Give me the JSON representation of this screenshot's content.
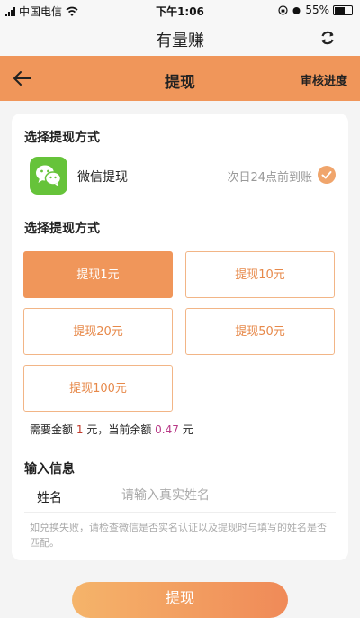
{
  "status_bar": {
    "carrier": "中国电信",
    "time": "下午1:06",
    "battery": "55%"
  },
  "app": {
    "title": "有量赚"
  },
  "nav": {
    "title": "提现",
    "action": "审核进度"
  },
  "method_section": {
    "title": "选择提现方式",
    "option_label": "微信提现",
    "option_note": "次日24点前到账"
  },
  "amount_section": {
    "title": "选择提现方式",
    "options": [
      {
        "label": "提现1元",
        "selected": true
      },
      {
        "label": "提现10元",
        "selected": false
      },
      {
        "label": "提现20元",
        "selected": false
      },
      {
        "label": "提现50元",
        "selected": false
      },
      {
        "label": "提现100元",
        "selected": false
      }
    ],
    "info_prefix": "需要金额",
    "required_amount": "1",
    "info_mid": "元，当前余额",
    "balance": "0.47",
    "info_suffix": "元"
  },
  "input_section": {
    "title": "输入信息",
    "name_label": "姓名",
    "name_placeholder": "请输入真实姓名",
    "hint": "如兑换失败，请检查微信是否实名认证以及提现时与填写的姓名是否匹配。"
  },
  "submit_label": "提现",
  "colors": {
    "accent": "#f0965a",
    "wechat_green": "#66c33a"
  }
}
